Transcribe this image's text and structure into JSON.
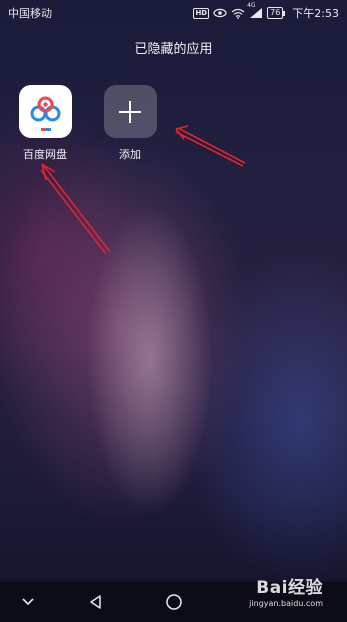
{
  "status_bar": {
    "carrier": "中国移动",
    "hd_badge": "HD",
    "network": "4G",
    "battery_level": "76",
    "time": "下午2:53",
    "icons": [
      "hd-icon",
      "eye-icon",
      "wifi-icon",
      "signal-icon",
      "battery-icon"
    ]
  },
  "page": {
    "title": "已隐藏的应用"
  },
  "apps": [
    {
      "label": "百度网盘",
      "icon": "baidu-netdisk-icon"
    },
    {
      "label": "添加",
      "icon": "plus-icon"
    }
  ],
  "annotations": {
    "arrow_color": "#e0242c",
    "count": 2
  },
  "nav_bar": {
    "buttons": [
      "collapse-icon",
      "back-icon",
      "home-icon"
    ]
  },
  "watermark": {
    "logo": "Bai经验",
    "url": "jingyan.baidu.com"
  }
}
